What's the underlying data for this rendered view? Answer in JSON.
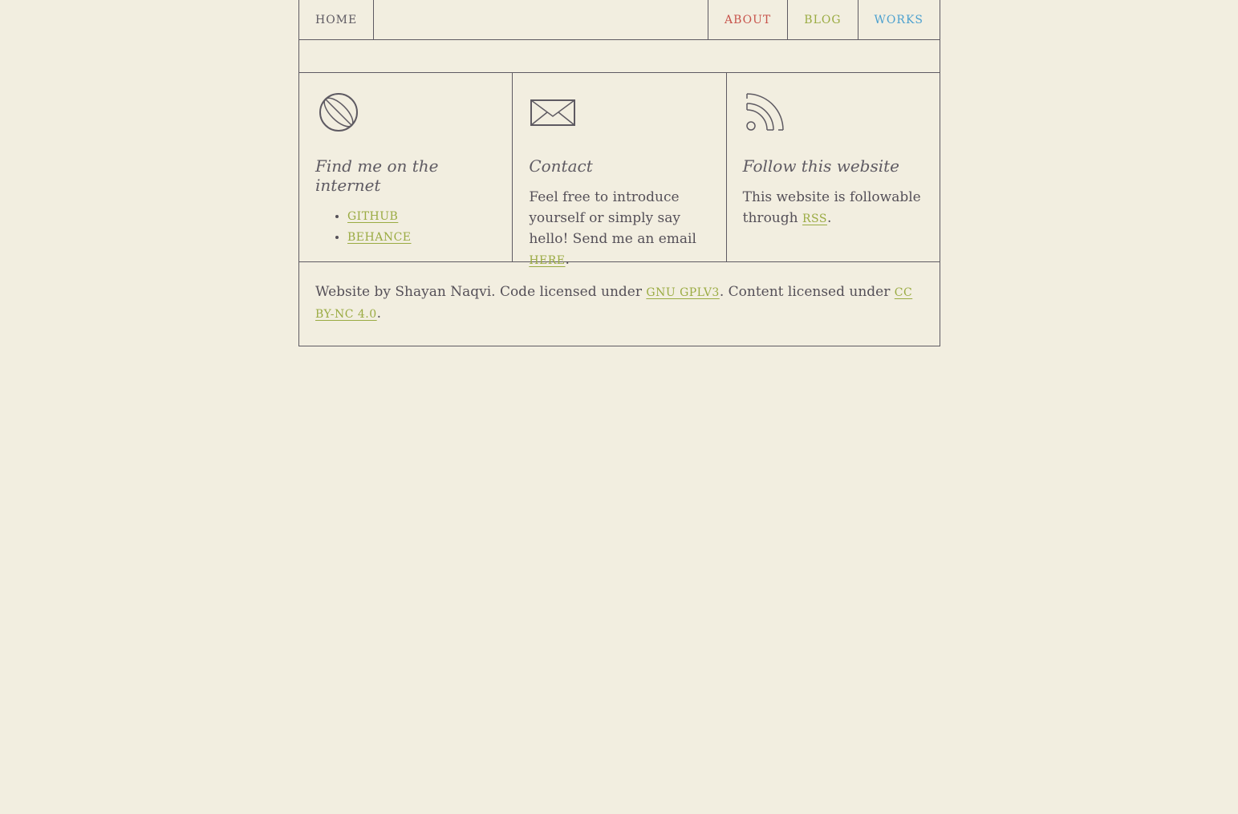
{
  "nav": {
    "home": "Home",
    "about": "About",
    "blog": "Blog",
    "works": "Works"
  },
  "panels": {
    "internet": {
      "icon": "globe-icon",
      "title": "Find me on the internet",
      "links": [
        "GitHub",
        "Behance"
      ]
    },
    "contact": {
      "icon": "envelope-icon",
      "title": "Contact",
      "text": "Feel free to introduce yourself or simply say hello! Send me an email",
      "link": "here",
      "suffix": "."
    },
    "follow": {
      "icon": "rss-icon",
      "title": "Follow this website",
      "text": "This website is followable through",
      "link": "RSS",
      "suffix": "."
    }
  },
  "footer": {
    "text1": "Website by Shayan Naqvi. Code licensed under",
    "link1": "GNU GPLv3",
    "text2": ". Content licensed under",
    "link2": "CC BY-NC 4.0",
    "text3": "."
  },
  "colors": {
    "background": "#f2eee0",
    "text": "#555058",
    "about": "#c7534b",
    "blog": "#9aab42",
    "works": "#4da1cf",
    "link": "#9aab42"
  }
}
